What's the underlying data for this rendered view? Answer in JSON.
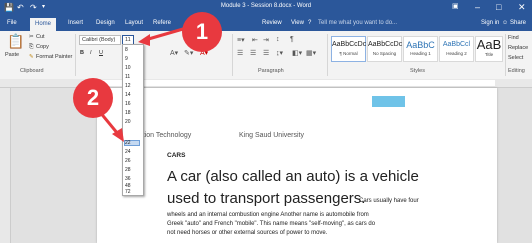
{
  "title_bar": {
    "title": "Module 3 - Session 8.docx - Word",
    "save_icon": "save-icon",
    "undo_icon": "undo-icon",
    "redo_icon": "redo-icon",
    "customize_icon": "quick-access-menu-icon",
    "ribbon_options": "ribbon-display-options-icon",
    "minimize": "–",
    "maximize": "□",
    "close": "✕"
  },
  "tabs": [
    "File",
    "Home",
    "Insert",
    "Design",
    "Layout",
    "Refere",
    "Review",
    "View"
  ],
  "tell_me": "Tell me what you want to do...",
  "sign_in": "Sign in",
  "share": "Share",
  "clipboard": {
    "paste": "Paste",
    "cut": "Cut",
    "copy": "Copy",
    "format_painter": "Format Painter",
    "group": "Clipboard"
  },
  "font": {
    "name": "Calibri (Body)",
    "size": "11",
    "bold": "B",
    "italic": "I",
    "underline": "U"
  },
  "paragraph": {
    "group": "Paragraph"
  },
  "styles": {
    "group": "Styles",
    "items": [
      {
        "preview": "AaBbCcDc",
        "name": "¶ Normal"
      },
      {
        "preview": "AaBbCcDc",
        "name": "No Spacing"
      },
      {
        "preview": "AaBbC",
        "name": "Heading 1"
      },
      {
        "preview": "AaBbCcl",
        "name": "Heading 2"
      },
      {
        "preview": "AaB",
        "name": "Title"
      }
    ]
  },
  "editing": {
    "find": "Find",
    "replace": "Replace",
    "select": "Select",
    "group": "Editing"
  },
  "font_size_dropdown": {
    "options": [
      "8",
      "9",
      "10",
      "11",
      "12",
      "14",
      "16",
      "18",
      "20",
      "22",
      "24",
      "26",
      "28",
      "36",
      "48",
      "72"
    ],
    "selected": "22"
  },
  "callouts": {
    "one": "1",
    "two": "2"
  },
  "document": {
    "header_left": "Information Technology",
    "header_right": "King Saud University",
    "heading": "CARS",
    "line1": "A car (also called an auto) is a vehicle",
    "line2_big": "used to transport passengers.",
    "line2_small": " Cars usually have four",
    "line3": "wheels and an internal combustion engine Another name is automobile from",
    "line4": "Greek \"auto\" and French \"mobile\". This name means \"self-moving\", as cars do",
    "line5": "not need horses or other external sources of power to move."
  },
  "colors": {
    "word_blue": "#2b579a",
    "callout_red": "#e8393f",
    "selection_blue": "#c5d9f1"
  }
}
